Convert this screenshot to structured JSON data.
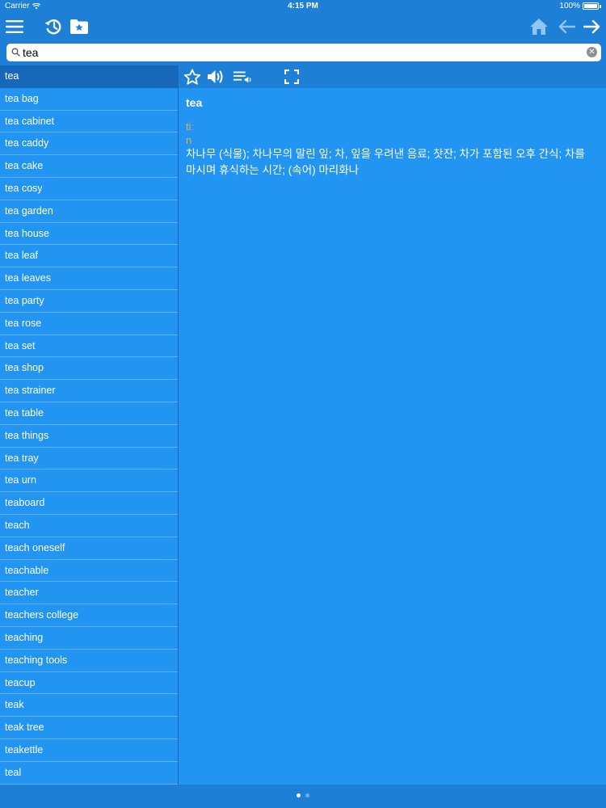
{
  "status_bar": {
    "carrier": "Carrier",
    "time": "4:15 PM",
    "battery": "100%"
  },
  "toolbar": {
    "menu_icon": "hamburger-menu-icon",
    "history_icon": "history-clock-icon",
    "favorites_icon": "star-folder-icon",
    "home_icon": "home-icon",
    "back_icon": "arrow-left-icon",
    "forward_icon": "arrow-right-icon"
  },
  "search": {
    "value": "tea",
    "placeholder": ""
  },
  "word_list": [
    "tea",
    "tea bag",
    "tea cabinet",
    "tea caddy",
    "tea cake",
    "tea cosy",
    "tea garden",
    "tea house",
    "tea leaf",
    "tea leaves",
    "tea party",
    "tea rose",
    "tea set",
    "tea shop",
    "tea strainer",
    "tea table",
    "tea things",
    "tea tray",
    "tea urn",
    "teaboard",
    "teach",
    "teach oneself",
    "teachable",
    "teacher",
    "teachers college",
    "teaching",
    "teaching tools",
    "teacup",
    "teak",
    "teak tree",
    "teakettle",
    "teal"
  ],
  "selected_index": 0,
  "detail_toolbar": {
    "favorite_icon": "star-outline-icon",
    "speaker_icon": "speaker-icon",
    "speak_list_icon": "speak-list-icon",
    "fullscreen_icon": "fullscreen-icon"
  },
  "entry": {
    "headword": "tea",
    "pronunciation": "tiː",
    "part_of_speech": "n",
    "meaning": "차나무 (식물); 차나무의 말린 잎; 차, 잎을 우려낸 음료; 찻잔; 차가 포함된 오후 간식; 차를 마시며 휴식하는 시간; (속어) 마리화나"
  },
  "colors": {
    "toolbar_bg": "#1E7FD6",
    "list_bg": "#2294F2",
    "selected_bg": "#1768B8",
    "accent_text": "#E0B24B"
  },
  "page_indicator": {
    "pages": 2,
    "current": 1
  }
}
